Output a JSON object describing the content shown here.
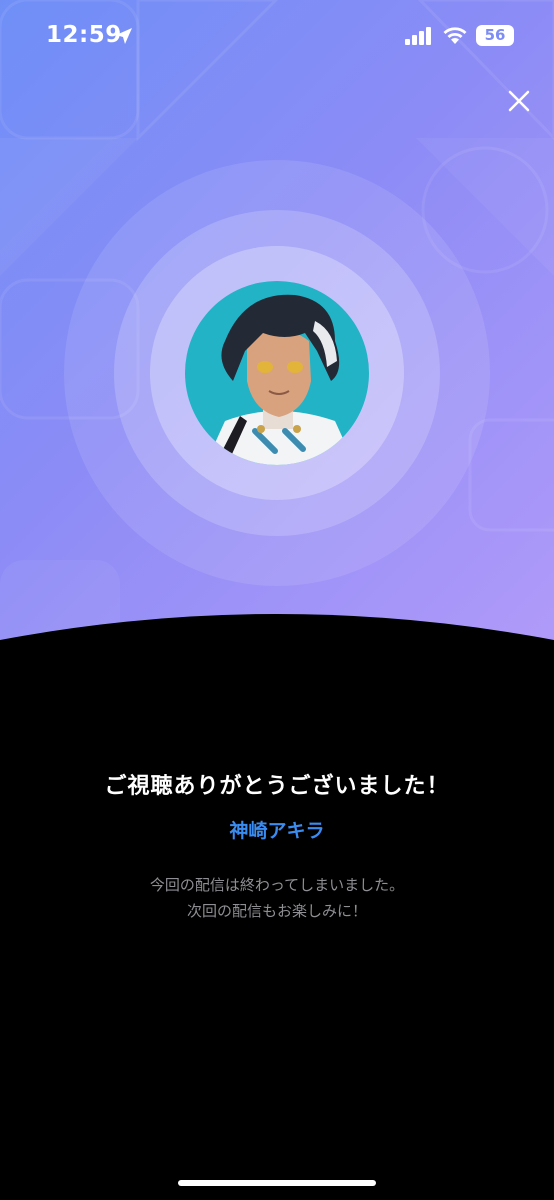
{
  "status_bar": {
    "time": "12:59",
    "battery": "56"
  },
  "header": {
    "close_icon": "close-icon"
  },
  "streamer": {
    "avatar_icon": "anime-character-avatar"
  },
  "end_screen": {
    "title": "ご視聴ありがとうございました！",
    "streamer_name": "神崎アキラ",
    "message_line1": "今回の配信は終わってしまいました。",
    "message_line2": "次回の配信もお楽しみに！"
  },
  "colors": {
    "gradient_start": "#6f8ff7",
    "gradient_end": "#b29bf9",
    "name_color": "#3b8cf0",
    "sub_text": "#8e8e93"
  }
}
